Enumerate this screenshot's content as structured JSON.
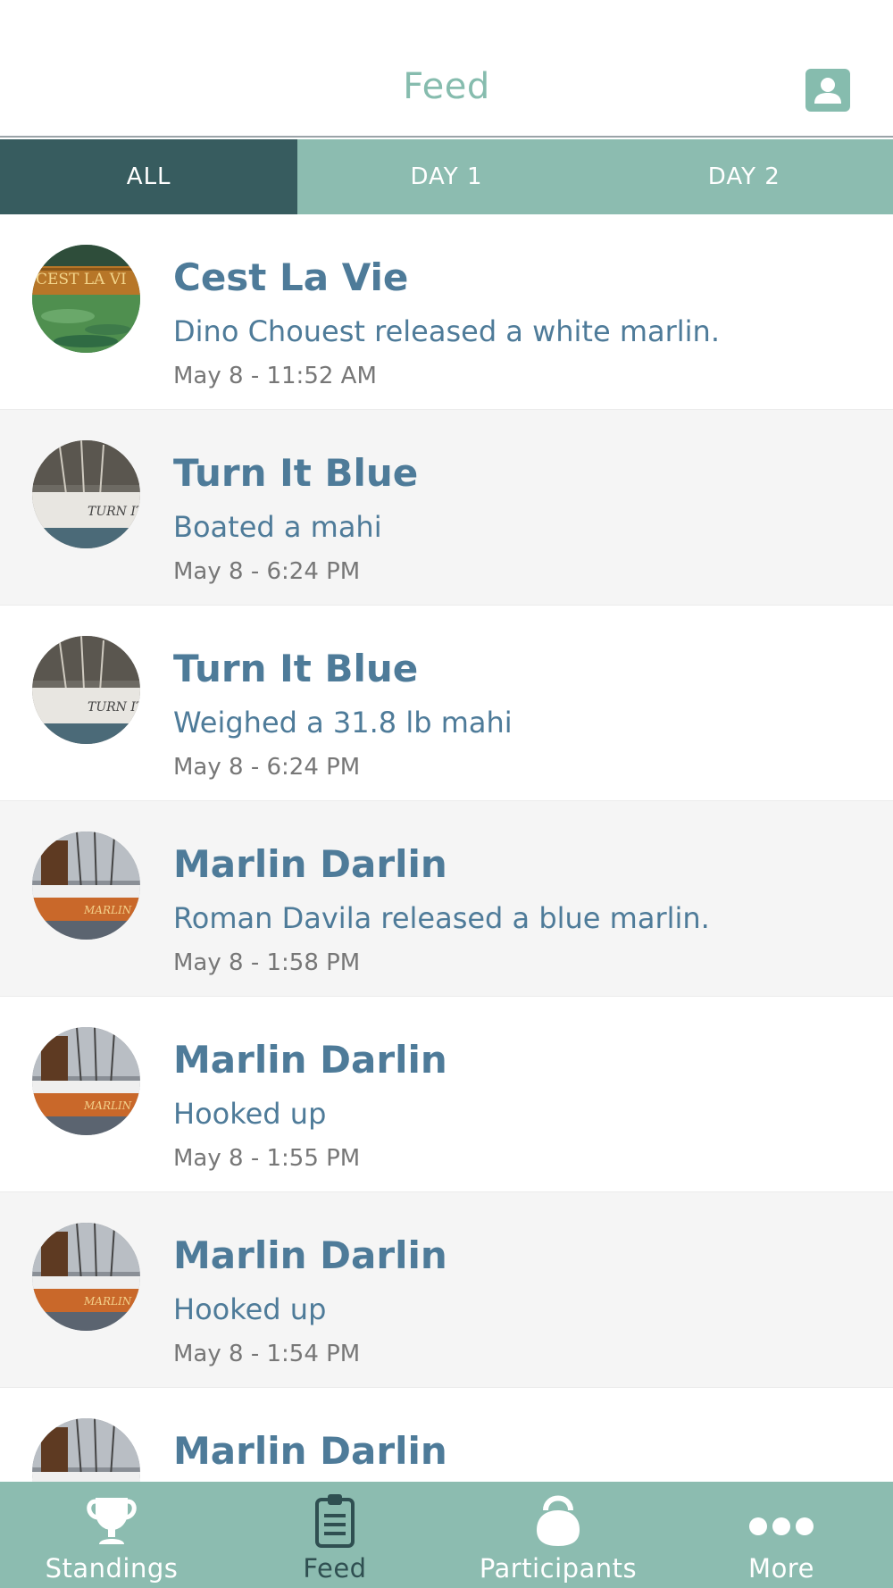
{
  "header": {
    "title": "Feed",
    "profile_icon": "user-icon"
  },
  "tabs": [
    {
      "label": "ALL",
      "active": true
    },
    {
      "label": "DAY 1",
      "active": false
    },
    {
      "label": "DAY 2",
      "active": false
    }
  ],
  "feed": [
    {
      "boat": "Cest La Vie",
      "text": "Dino Chouest released a white marlin.",
      "time": "May 8 - 11:52 AM",
      "avatar": "cest-la-vie-photo"
    },
    {
      "boat": "Turn It Blue",
      "text": "Boated a mahi",
      "time": "May 8 - 6:24 PM",
      "avatar": "turn-it-blue-photo"
    },
    {
      "boat": "Turn It Blue",
      "text": "Weighed a 31.8 lb mahi",
      "time": "May 8 - 6:24 PM",
      "avatar": "turn-it-blue-photo"
    },
    {
      "boat": "Marlin Darlin",
      "text": "Roman Davila released a blue marlin.",
      "time": "May 8 - 1:58 PM",
      "avatar": "marlin-darlin-photo"
    },
    {
      "boat": "Marlin Darlin",
      "text": "Hooked up",
      "time": "May 8 - 1:55 PM",
      "avatar": "marlin-darlin-photo"
    },
    {
      "boat": "Marlin Darlin",
      "text": "Hooked up",
      "time": "May 8 - 1:54 PM",
      "avatar": "marlin-darlin-photo"
    },
    {
      "boat": "Marlin Darlin",
      "text": "",
      "time": "",
      "avatar": "marlin-darlin-photo"
    }
  ],
  "bottom_nav": [
    {
      "label": "Standings",
      "icon": "trophy-icon",
      "active": false
    },
    {
      "label": "Feed",
      "icon": "clipboard-icon",
      "active": true
    },
    {
      "label": "Participants",
      "icon": "kettlebell-icon",
      "active": false
    },
    {
      "label": "More",
      "icon": "more-dots-icon",
      "active": false
    }
  ],
  "colors": {
    "accent": "#86bcae",
    "tab_active": "#375c5f",
    "nav_bg": "#8cbcb0",
    "title_text": "#4e7b99",
    "status_indicator": "#e2473a"
  }
}
